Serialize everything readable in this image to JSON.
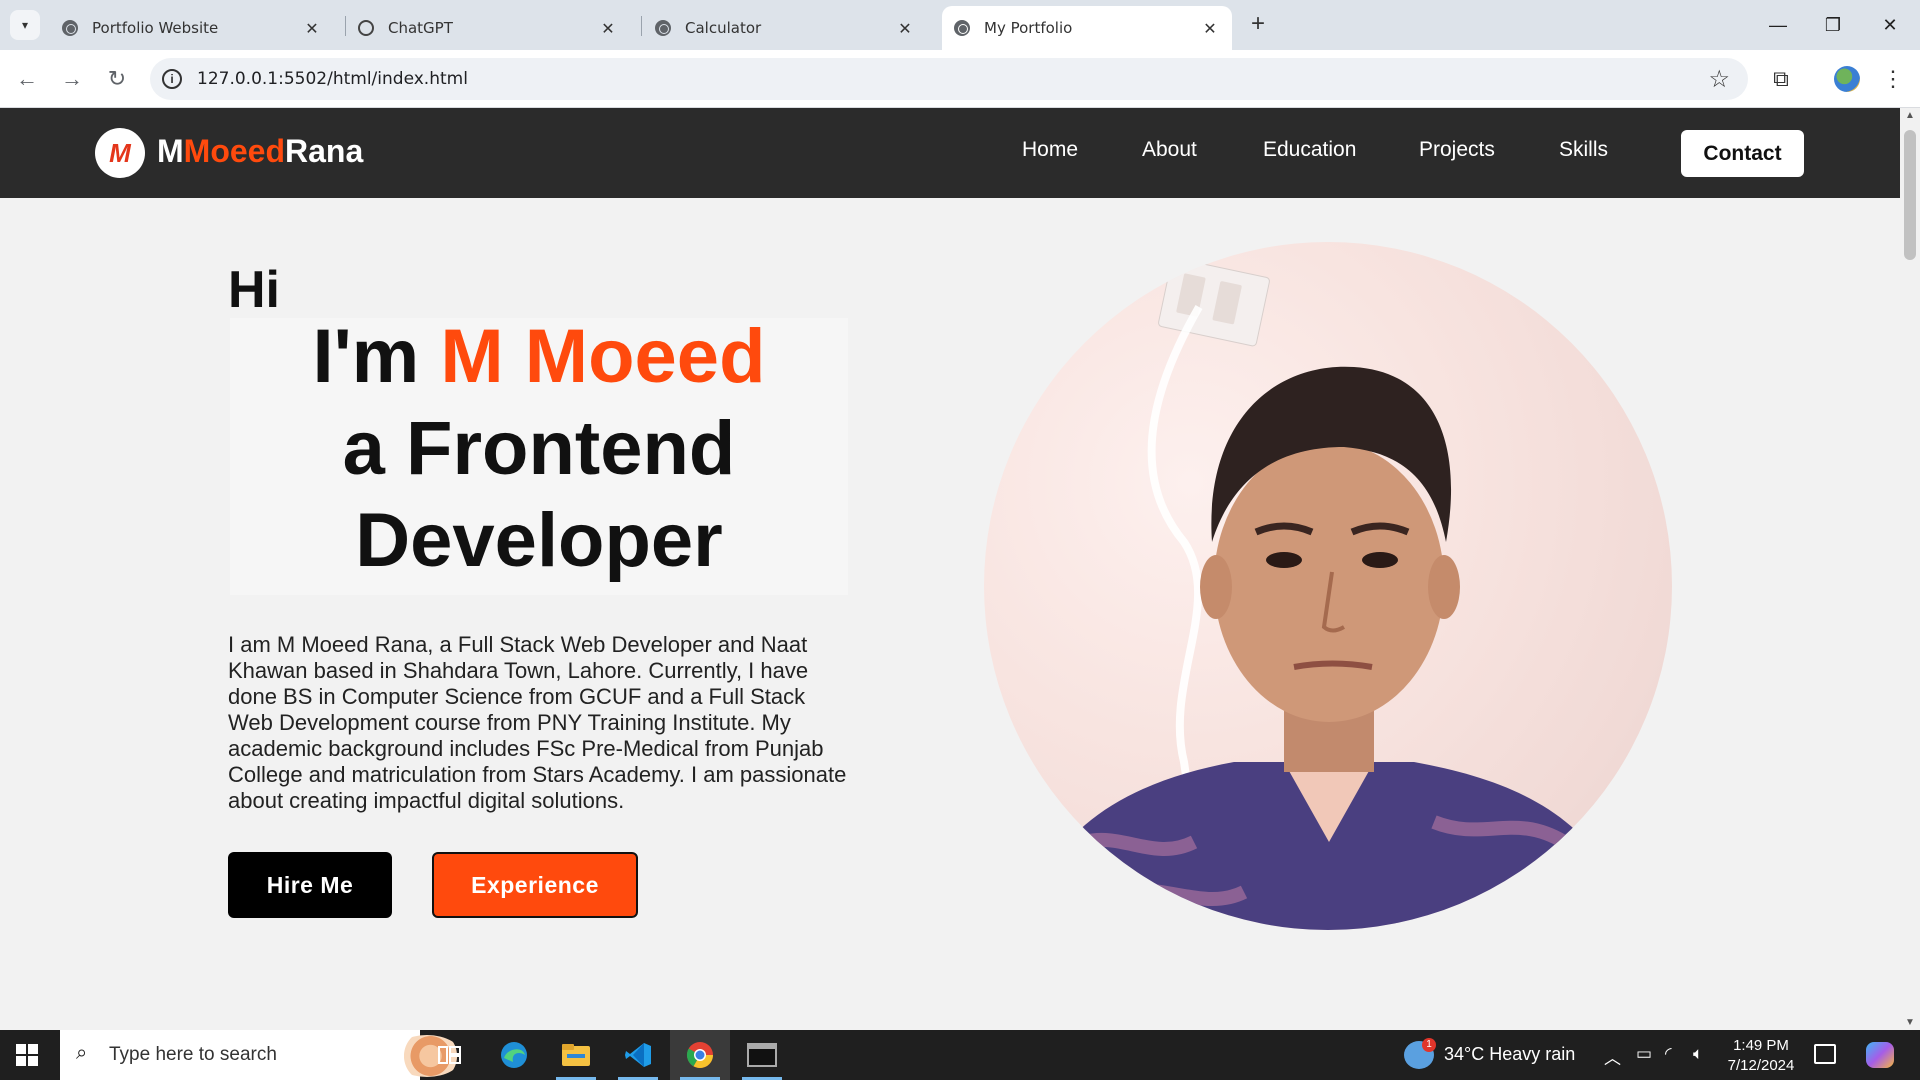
{
  "browser": {
    "tabs": [
      {
        "title": "Portfolio Website",
        "active": false
      },
      {
        "title": "ChatGPT",
        "active": false
      },
      {
        "title": "Calculator",
        "active": false
      },
      {
        "title": "My Portfolio",
        "active": true
      }
    ],
    "close_glyph": "✕",
    "new_tab_glyph": "+",
    "url": "127.0.0.1:5502/html/index.html"
  },
  "site": {
    "logo_letter": "M",
    "brand": {
      "part1": "M",
      "part2": "Moeed",
      "part3": "Rana"
    },
    "nav": [
      "Home",
      "About",
      "Education",
      "Projects",
      "Skills"
    ],
    "contact_label": "Contact",
    "greeting": "Hi",
    "headline": {
      "prefix": "I'm ",
      "name": "M Moeed",
      "line2": "a Frontend",
      "line3": "Developer"
    },
    "bio": "I am M Moeed Rana, a Full Stack Web Developer and Naat Khawan based in Shahdara Town, Lahore. Currently, I have done BS in Computer Science from GCUF and a Full Stack Web Development course from PNY Training Institute. My academic background includes FSc Pre-Medical from Punjab College and matriculation from Stars Academy. I am passionate about creating impactful digital solutions.",
    "hire_label": "Hire Me",
    "experience_label": "Experience",
    "accent_color": "#ff4a0d"
  },
  "taskbar": {
    "search_placeholder": "Type here to search",
    "weather_badge": "1",
    "weather": "34°C  Heavy rain",
    "time": "1:49 PM",
    "date": "7/12/2024"
  }
}
